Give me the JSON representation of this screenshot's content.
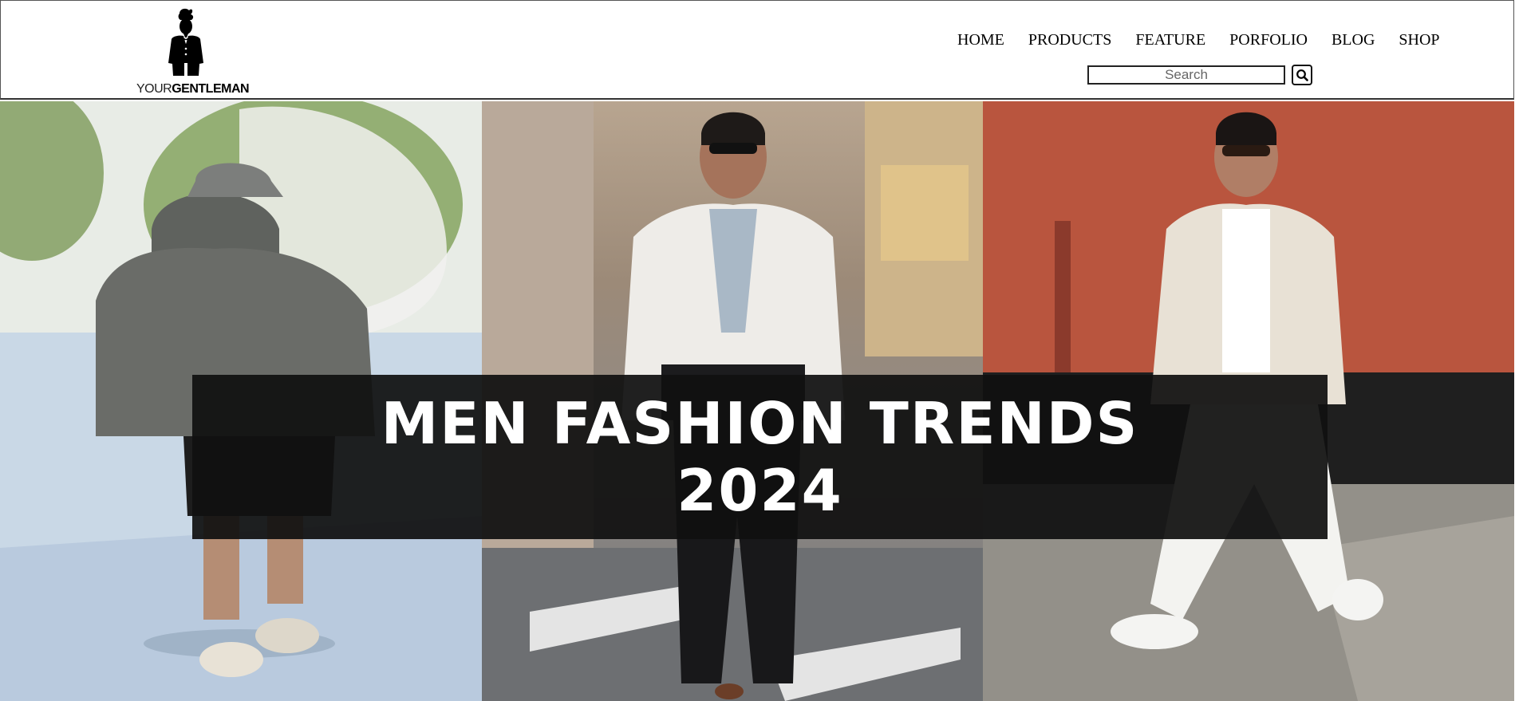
{
  "logo": {
    "text_light": "YOUR",
    "text_bold": "GENTLEMAN"
  },
  "nav": {
    "items": [
      {
        "label": "HOME"
      },
      {
        "label": "PRODUCTS"
      },
      {
        "label": "FEATURE"
      },
      {
        "label": "PORFOLIO"
      },
      {
        "label": "BLOG"
      },
      {
        "label": "SHOP"
      }
    ]
  },
  "search": {
    "placeholder": "Search",
    "icon": "search-icon"
  },
  "hero": {
    "title_line1": "MEN FASHION TRENDS",
    "title_line2": "2024"
  }
}
